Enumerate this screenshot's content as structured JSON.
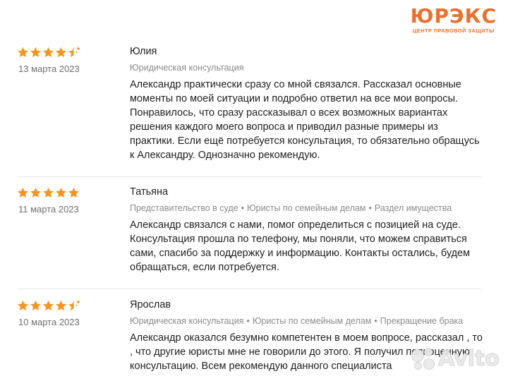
{
  "brand": {
    "logo_main": "ЮРЭКС",
    "logo_sub": "ЦЕНТР ПРАВОВОЙ ЗАЩИТЫ",
    "accent_color": "#e8712c"
  },
  "star_color": "#f7941d",
  "reviews": [
    {
      "name": "Юлия",
      "date": "13 марта 2023",
      "rating": 4.5,
      "tags": [
        "Юридическая консультация"
      ],
      "text": "Александр практически сразу со мной связался. Рассказал основные моменты по моей ситуации и подробно ответил на все мои вопросы. Понравилось, что сразу рассказывал о всех возможных вариантах решения каждого моего вопроса и приводил разные примеры из практики. Если ещё потребуется консультация, то обязательно обращусь к Александру. Однозначно рекомендую."
    },
    {
      "name": "Татьяна",
      "date": "11 марта 2023",
      "rating": 5,
      "tags": [
        "Представительство в суде",
        "Юристы по семейным делам",
        "Раздел имущества"
      ],
      "text": "Александр связался с нами, помог определиться с позицией на суде. Консультация прошла по телефону, мы поняли, что можем справиться сами, спасибо за поддержку и информацию. Контакты остались, будем обращаться, если потребуется."
    },
    {
      "name": "Ярослав",
      "date": "10 марта 2023",
      "rating": 4.5,
      "tags": [
        "Юридическая консультация",
        "Юристы по семейным делам",
        "Прекращение брака"
      ],
      "text": "Александр оказался безумно компетентен в моем вопросе, рассказал , то , что другие юристы мне не говорили до этого. Я получил полноценную консультацию. Всем рекомендую данного специалиста"
    }
  ],
  "tag_separator": "•",
  "watermark": "Avito"
}
